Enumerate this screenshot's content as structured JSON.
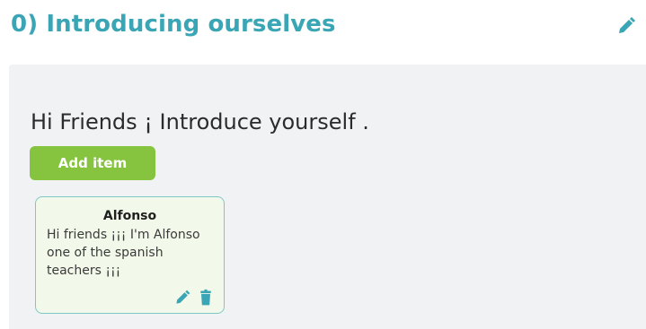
{
  "section": {
    "title": "0) Introducing ourselves",
    "edit_icon": "pencil-icon"
  },
  "panel": {
    "heading": "Hi Friends ¡ Introduce yourself .",
    "add_item_label": "Add item"
  },
  "items": [
    {
      "author": "Alfonso",
      "text": "Hi friends ¡¡¡ I'm Alfonso one of the spanish teachers ¡¡¡",
      "actions": [
        "pencil-icon",
        "trash-icon"
      ]
    }
  ],
  "colors": {
    "accent": "#3aa6b5",
    "button": "#86c43f",
    "card_border": "#7fc7c7",
    "card_bg": "#f3f9ea",
    "panel_bg": "#f0f2f4"
  }
}
